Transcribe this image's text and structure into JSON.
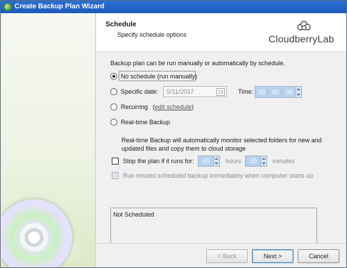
{
  "window": {
    "title": "Create Backup Plan Wizard"
  },
  "header": {
    "title": "Schedule",
    "subtitle": "Specify schedule options",
    "logo_text": "CloudberryLab"
  },
  "content": {
    "intro": "Backup plan can be run manually or automatically by schedule.",
    "options": {
      "no_schedule": "No schedule (run manually)",
      "specific_date": "Specific date:",
      "recurring": "Recurring",
      "edit_schedule": "edit schedule",
      "realtime": "Real-time Backup"
    },
    "selected_option": "no_schedule",
    "date_value": "5/11/2017",
    "calendar_day": "15",
    "time_label": "Time:",
    "time": {
      "hours": "00",
      "minutes": "00",
      "seconds": "00"
    },
    "realtime_description": "Real-time Backup will automatically monitor selected folders for new and updated files and copy them to cloud storage",
    "stop_plan": {
      "label": "Stop the plan if it runs for:",
      "hours_value": "00",
      "hours_label": "hours",
      "minutes_value": "00",
      "minutes_label": "minutes",
      "checked": false
    },
    "run_missed": {
      "label": "Run missed scheduled backup immediately when computer starts up",
      "checked": false
    },
    "status_text": "Not Scheduled"
  },
  "buttons": {
    "back": "< Back",
    "next": "Next >",
    "cancel": "Cancel"
  }
}
